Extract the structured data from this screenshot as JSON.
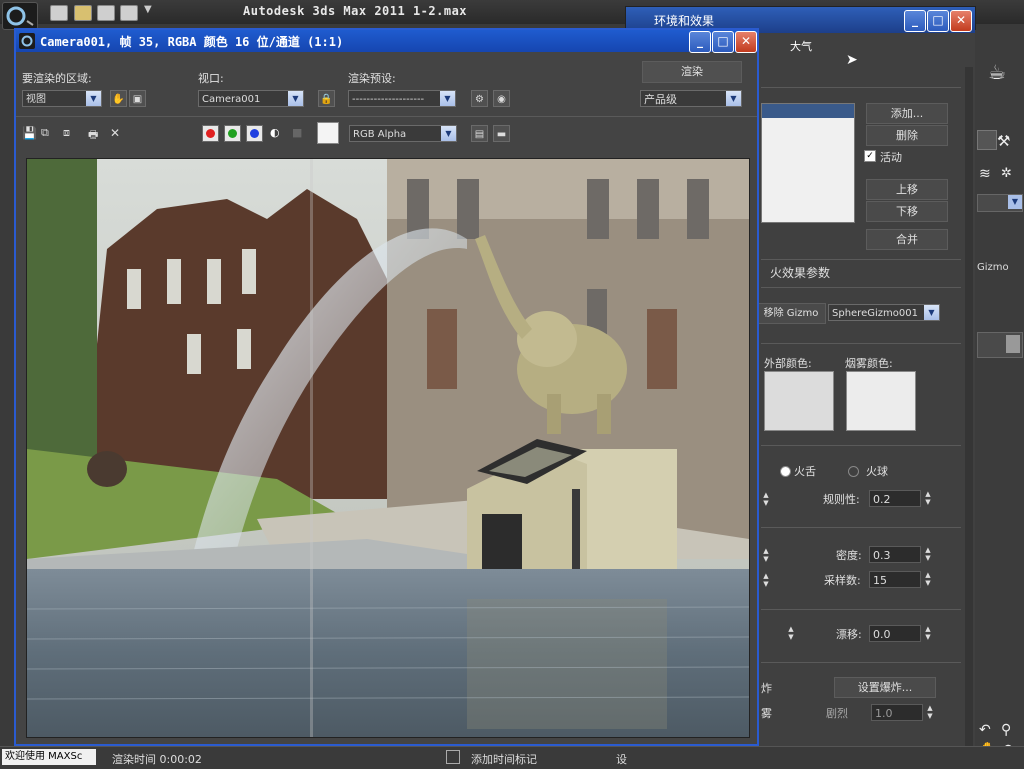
{
  "app": {
    "title": "Autodesk 3ds Max  2011       1-2.max"
  },
  "render_window": {
    "title": "Camera001, 帧 35, RGBA 颜色 16 位/通道 (1:1)",
    "area_label": "要渲染的区域:",
    "area_value": "视图",
    "viewport_label": "视口:",
    "viewport_value": "Camera001",
    "preset_label": "渲染预设:",
    "preset_value": "--------------------",
    "render_button": "渲染",
    "quality_value": "产品级",
    "channel_value": "RGB Alpha",
    "colors": {
      "red": "#e02020",
      "green": "#20a020",
      "blue": "#2040e0"
    }
  },
  "env_dialog": {
    "title": "环境和效果",
    "tab_atmosphere": "大气",
    "add_button": "添加...",
    "delete_button": "删除",
    "active_label": "活动",
    "move_up_button": "上移",
    "move_down_button": "下移",
    "merge_button": "合并",
    "fire_params_title": "火效果参数",
    "remove_gizmo_button": "移除 Gizmo",
    "gizmo_value": "SphereGizmo001",
    "inner_color_label": "外部颜色:",
    "smoke_color_label": "烟雾颜色:",
    "fire_tongue_label": "火舌",
    "fireball_label": "火球",
    "regularity_label": "规则性:",
    "regularity_value": "0.2",
    "density_label": "密度:",
    "density_value": "0.3",
    "samples_label": "采样数:",
    "samples_value": "15",
    "drift_label": "漂移:",
    "drift_value": "0.0",
    "explosion_button": "设置爆炸...",
    "explosion_partial": "炸",
    "explosion_partial2": "雾",
    "severity_label": "剧烈",
    "severity_value": "1.0"
  },
  "right_panel": {
    "gizmo_label": "Gizmo"
  },
  "status_bar": {
    "welcome": "欢迎使用 MAXSc",
    "render_time": "渲染时间  0:00:02",
    "add_time_tag": "添加时间标记",
    "settings": "设"
  }
}
